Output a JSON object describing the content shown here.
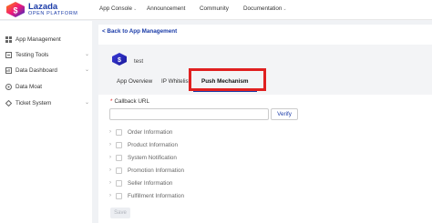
{
  "header": {
    "logo_title": "Lazada",
    "logo_subtitle": "OPEN PLATFORM",
    "nav": [
      {
        "label": "App Console",
        "has_dropdown": true
      },
      {
        "label": "Announcement",
        "has_dropdown": false
      },
      {
        "label": "Community",
        "has_dropdown": false
      },
      {
        "label": "Documentation",
        "has_dropdown": true
      }
    ]
  },
  "sidebar": {
    "items": [
      {
        "label": "App Management",
        "icon": "grid-icon",
        "expandable": false
      },
      {
        "label": "Testing Tools",
        "icon": "tools-icon",
        "expandable": true
      },
      {
        "label": "Data Dashboard",
        "icon": "dashboard-icon",
        "expandable": true
      },
      {
        "label": "Data Moat",
        "icon": "database-icon",
        "expandable": false
      },
      {
        "label": "Ticket System",
        "icon": "ticket-icon",
        "expandable": true
      }
    ]
  },
  "main": {
    "back_label": "< Back to App Management",
    "app_name": "test",
    "tabs": [
      {
        "label": "App Overview",
        "active": false
      },
      {
        "label": "IP Whitelist",
        "active": false
      },
      {
        "label": "Push Mechanism",
        "active": true
      }
    ],
    "callback": {
      "required_mark": "*",
      "label": "Callback URL",
      "value": "",
      "verify_label": "Verify"
    },
    "permissions": [
      {
        "label": "Order Information",
        "checked": false
      },
      {
        "label": "Product Information",
        "checked": false
      },
      {
        "label": "System Notification",
        "checked": false
      },
      {
        "label": "Promotion Information",
        "checked": false
      },
      {
        "label": "Seller Information",
        "checked": false
      },
      {
        "label": "Fulfillment Information",
        "checked": false
      }
    ],
    "save_label": "Save"
  },
  "colors": {
    "brand": "#1a3ba8",
    "highlight": "#e02020"
  }
}
